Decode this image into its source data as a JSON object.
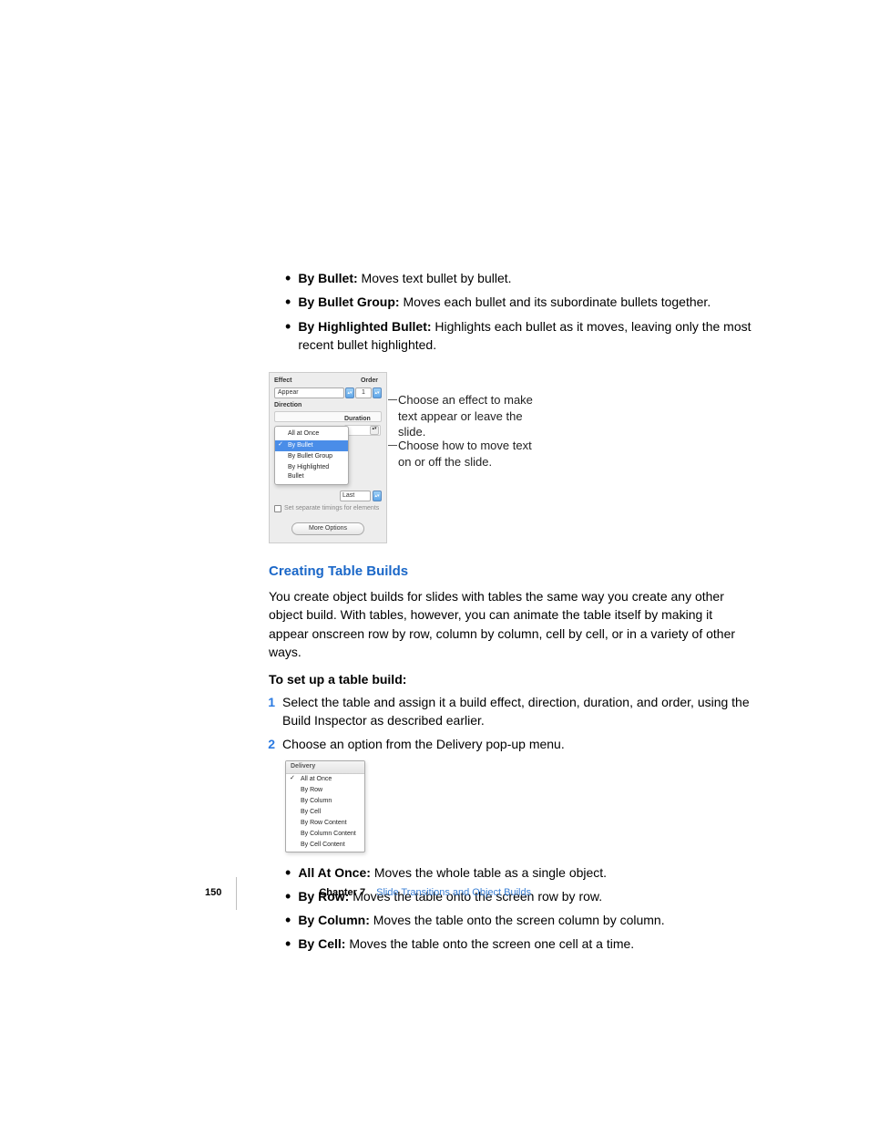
{
  "bullets_top": [
    {
      "label": "By Bullet:",
      "text": "Moves text bullet by bullet."
    },
    {
      "label": "By Bullet Group:",
      "text": "Moves each bullet and its subordinate bullets together."
    },
    {
      "label": "By Highlighted Bullet:",
      "text": "Highlights each bullet as it moves, leaving only the most recent bullet highlighted."
    }
  ],
  "inspector": {
    "effect_label": "Effect",
    "order_label": "Order",
    "effect_value": "Appear",
    "order_value": "1",
    "direction_label": "Direction",
    "duration_label": "Duration",
    "popup_items": [
      "All at Once",
      "By Bullet",
      "By Bullet Group",
      "By Highlighted Bullet"
    ],
    "popup_selected": "By Bullet",
    "last_label": "Last",
    "checkbox_label": "Set separate timings for elements",
    "more_options": "More Options"
  },
  "callouts": {
    "c1": "Choose an effect to make text appear or leave the slide.",
    "c2": "Choose how to move text on or off the slide."
  },
  "section": {
    "heading": "Creating Table Builds",
    "para": "You create object builds for slides with tables the same way you create any other object build. With tables, however, you can animate the table itself by making it appear onscreen row by row, column by column, cell by cell, or in a variety of other ways.",
    "subhead": "To set up a table build:",
    "steps": [
      {
        "num": "1",
        "text": "Select the table and assign it a build effect, direction, duration, and order, using the Build Inspector as described earlier."
      },
      {
        "num": "2",
        "text": "Choose an option from the Delivery pop-up menu."
      }
    ]
  },
  "delivery_popup": {
    "header": "Delivery",
    "items": [
      "All at Once",
      "By Row",
      "By Column",
      "By Cell",
      "By Row Content",
      "By Column Content",
      "By Cell Content"
    ],
    "selected": "All at Once"
  },
  "bullets_bottom": [
    {
      "label": "All At Once:",
      "text": "Moves the whole table as a single object."
    },
    {
      "label": "By Row:",
      "text": "Moves the table onto the screen row by row."
    },
    {
      "label": "By Column:",
      "text": "Moves the table onto the screen column by column."
    },
    {
      "label": "By Cell:",
      "text": "Moves the table onto the screen one cell at a time."
    }
  ],
  "footer": {
    "page": "150",
    "chapter_label": "Chapter 7",
    "chapter_title": "Slide Transitions and Object Builds"
  }
}
